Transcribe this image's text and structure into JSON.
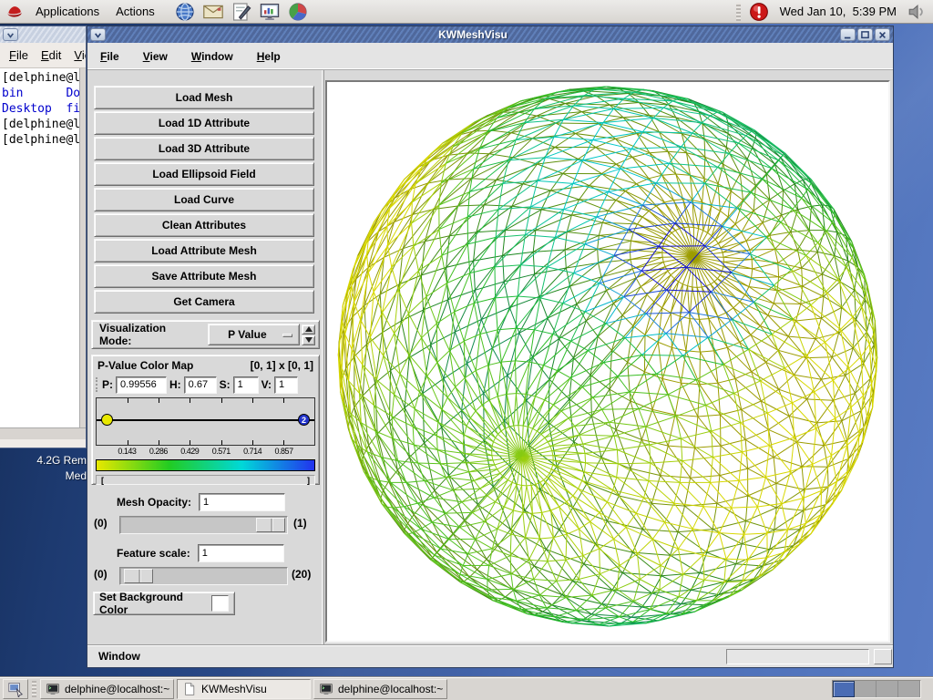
{
  "top_panel": {
    "menus": [
      {
        "label": "Applications"
      },
      {
        "label": "Actions"
      }
    ],
    "launchers": [
      "web-browser",
      "email",
      "word-processor",
      "presentation",
      "spreadsheet"
    ],
    "clock": "Wed Jan 10,  5:39 PM"
  },
  "terminal_window": {
    "menu_items": [
      "File",
      "Edit",
      "View"
    ],
    "lines": [
      {
        "text": "[delphine@l",
        "color": "#000000"
      },
      {
        "text": "bin      Do",
        "color": "#0000cd"
      },
      {
        "text": "Desktop  fi",
        "color": "#0000cd"
      },
      {
        "text": "[delphine@l",
        "color": "#000000"
      },
      {
        "text": "[delphine@l",
        "color": "#000000"
      }
    ]
  },
  "desktop": {
    "icon_label": [
      "4.2G Rem",
      "Med"
    ]
  },
  "app_window": {
    "title": "KWMeshVisu",
    "menus": [
      "File",
      "View",
      "Window",
      "Help"
    ],
    "action_buttons": [
      "Load Mesh",
      "Load 1D Attribute",
      "Load 3D Attribute",
      "Load Ellipsoid Field",
      "Load Curve",
      "Clean Attributes",
      "Load Attribute Mesh",
      "Save Attribute Mesh",
      "Get Camera"
    ],
    "visualization_mode": {
      "label": "Visualization Mode:",
      "value": "P Value"
    },
    "colormap_panel": {
      "title": "P-Value Color Map",
      "range_label": "[0, 1] x [0, 1]",
      "fields": [
        {
          "label": "P:",
          "value": "0.99556"
        },
        {
          "label": "H:",
          "value": "0.67"
        },
        {
          "label": "S:",
          "value": "1"
        },
        {
          "label": "V:",
          "value": "1"
        }
      ],
      "axis_ticks": [
        "0.143",
        "0.286",
        "0.429",
        "0.571",
        "0.714",
        "0.857"
      ],
      "left_node_color": "#e8e800",
      "right_node_color": "#2233cc",
      "right_node_label": "2",
      "gradient_stops": [
        "#e8e800",
        "#22cc22",
        "#00d8d8",
        "#2233ee"
      ]
    },
    "mesh_opacity": {
      "label": "Mesh Opacity:",
      "value": "1",
      "min": "(0)",
      "max": "(1)"
    },
    "feature_scale": {
      "label": "Feature scale:",
      "value": "1",
      "min": "(0)",
      "max": "(20)"
    },
    "background_button": {
      "label": "Set Background Color",
      "swatch_color": "#ffffff"
    },
    "status_label": "Window"
  },
  "render_view": {
    "background": "#ffffff",
    "colormap": [
      "#d8d800",
      "#28bb28",
      "#00c8c8",
      "#2277dd",
      "#1111cc"
    ],
    "mesh": {
      "lat_bands": 26,
      "lon_bands": 40
    }
  },
  "taskbar": {
    "buttons": [
      {
        "label": "delphine@localhost:~",
        "icon": "terminal",
        "active": false
      },
      {
        "label": "KWMeshVisu",
        "icon": "document",
        "active": true
      },
      {
        "label": "delphine@localhost:~",
        "icon": "terminal",
        "active": false
      }
    ],
    "workspace_count": 4,
    "active_workspace": 0
  }
}
